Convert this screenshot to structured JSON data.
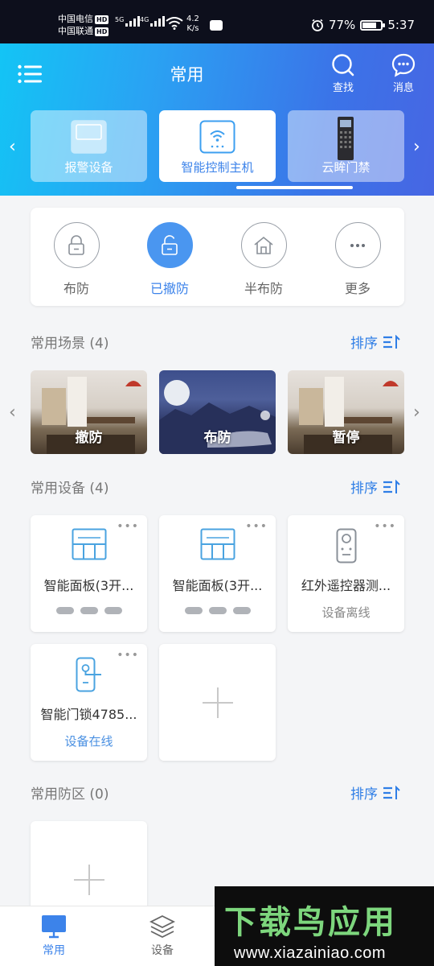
{
  "status_bar": {
    "carrier1": "中国电信",
    "carrier2": "中国联通",
    "hd": "HD",
    "net1": "5G",
    "net2": "4G",
    "speed_value": "4.2",
    "speed_unit": "K/s",
    "battery": "77%",
    "battery_level": 0.77,
    "time": "5:37"
  },
  "header": {
    "title": "常用",
    "search_label": "查找",
    "message_label": "消息"
  },
  "device_tabs": [
    {
      "label": "报警设备",
      "icon": "alarm-panel-icon",
      "active": false
    },
    {
      "label": "智能控制主机",
      "icon": "wifi-hub-icon",
      "active": true
    },
    {
      "label": "云眸门禁",
      "icon": "door-station-icon",
      "active": false
    }
  ],
  "arm_modes": [
    {
      "label": "布防",
      "icon": "lock-closed-icon",
      "active": false
    },
    {
      "label": "已撤防",
      "icon": "lock-open-icon",
      "active": true
    },
    {
      "label": "半布防",
      "icon": "home-icon",
      "active": false
    },
    {
      "label": "更多",
      "icon": "more-icon",
      "active": false
    }
  ],
  "scenes_section": {
    "title": "常用场景 (4)",
    "sort_label": "排序"
  },
  "scenes": [
    {
      "name": "撤防"
    },
    {
      "name": "布防"
    },
    {
      "name": "暂停"
    }
  ],
  "devices_section": {
    "title": "常用设备 (4)",
    "sort_label": "排序"
  },
  "devices": [
    {
      "name": "智能面板(3开...",
      "icon": "switch-panel-icon"
    },
    {
      "name": "智能面板(3开...",
      "icon": "switch-panel-icon"
    },
    {
      "name": "红外遥控器测...",
      "icon": "ir-remote-icon",
      "status": "设备离线"
    },
    {
      "name": "智能门锁4785...",
      "icon": "door-lock-icon",
      "status": "设备在线"
    }
  ],
  "zones_section": {
    "title": "常用防区 (0)",
    "sort_label": "排序"
  },
  "bottom_nav": [
    {
      "label": "常用",
      "active": true
    },
    {
      "label": "设备",
      "active": false
    }
  ],
  "watermark": {
    "logo": "下载鸟应用",
    "url": "www.xiazainiao.com"
  },
  "colors": {
    "accent": "#3c83ea",
    "online": "#4a90e2",
    "offline": "#888888"
  }
}
